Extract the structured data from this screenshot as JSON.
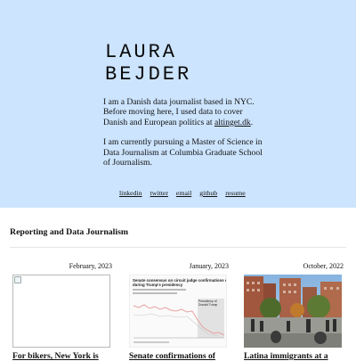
{
  "profile": {
    "name_line1": "LAURA",
    "name_line2": "BEJDER",
    "bio_p1_text": "I am a Danish data journalist based in NYC. Before moving here, I used data to cover Danish and European politics at ",
    "bio_p1_link": "altinget.dk",
    "bio_p1_end": ".",
    "bio_p2": "I am currently pursuing a Master of Science in Data Journalism at Columbia Graduate School of Journalism."
  },
  "links": [
    "linkedin",
    "twitter",
    "email",
    "github",
    "resume"
  ],
  "section_title": "Reporting and Data Journalism",
  "articles": [
    {
      "date": "February, 2023",
      "headline": "For bikers, New York is",
      "thumb": "broken"
    },
    {
      "date": "January, 2023",
      "headline": "Senate confirmations of",
      "thumb": "chart",
      "thumb_title": "Senate consensus on circuit judge confirmations dropped during Trump's presidency",
      "thumb_label": "Presidency of Donald Trump"
    },
    {
      "date": "October, 2022",
      "headline": "Latina immigrants at a",
      "thumb": "photo"
    }
  ],
  "colors": {
    "hero_bg": "#cce4fd",
    "text": "#111111",
    "chart_line": "#e8a0a0"
  }
}
